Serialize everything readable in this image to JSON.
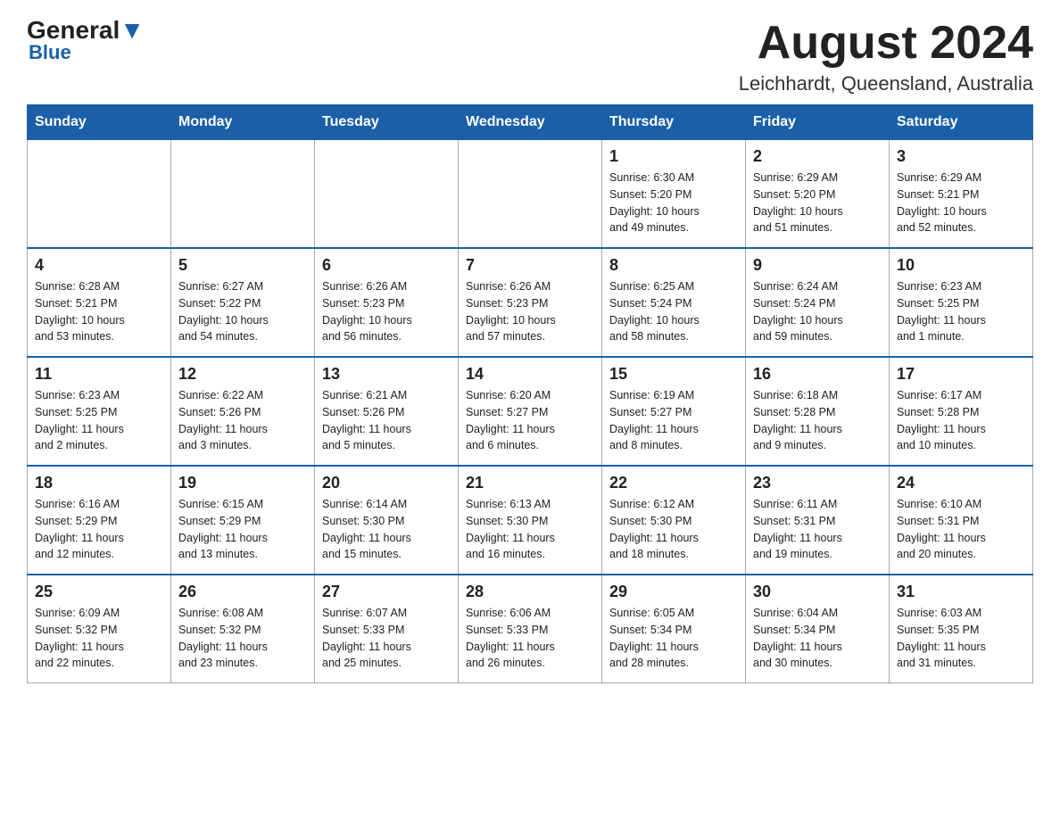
{
  "header": {
    "logo_general": "General",
    "logo_blue": "Blue",
    "month_title": "August 2024",
    "location": "Leichhardt, Queensland, Australia"
  },
  "days_of_week": [
    "Sunday",
    "Monday",
    "Tuesday",
    "Wednesday",
    "Thursday",
    "Friday",
    "Saturday"
  ],
  "weeks": [
    [
      {
        "day": "",
        "info": ""
      },
      {
        "day": "",
        "info": ""
      },
      {
        "day": "",
        "info": ""
      },
      {
        "day": "",
        "info": ""
      },
      {
        "day": "1",
        "info": "Sunrise: 6:30 AM\nSunset: 5:20 PM\nDaylight: 10 hours\nand 49 minutes."
      },
      {
        "day": "2",
        "info": "Sunrise: 6:29 AM\nSunset: 5:20 PM\nDaylight: 10 hours\nand 51 minutes."
      },
      {
        "day": "3",
        "info": "Sunrise: 6:29 AM\nSunset: 5:21 PM\nDaylight: 10 hours\nand 52 minutes."
      }
    ],
    [
      {
        "day": "4",
        "info": "Sunrise: 6:28 AM\nSunset: 5:21 PM\nDaylight: 10 hours\nand 53 minutes."
      },
      {
        "day": "5",
        "info": "Sunrise: 6:27 AM\nSunset: 5:22 PM\nDaylight: 10 hours\nand 54 minutes."
      },
      {
        "day": "6",
        "info": "Sunrise: 6:26 AM\nSunset: 5:23 PM\nDaylight: 10 hours\nand 56 minutes."
      },
      {
        "day": "7",
        "info": "Sunrise: 6:26 AM\nSunset: 5:23 PM\nDaylight: 10 hours\nand 57 minutes."
      },
      {
        "day": "8",
        "info": "Sunrise: 6:25 AM\nSunset: 5:24 PM\nDaylight: 10 hours\nand 58 minutes."
      },
      {
        "day": "9",
        "info": "Sunrise: 6:24 AM\nSunset: 5:24 PM\nDaylight: 10 hours\nand 59 minutes."
      },
      {
        "day": "10",
        "info": "Sunrise: 6:23 AM\nSunset: 5:25 PM\nDaylight: 11 hours\nand 1 minute."
      }
    ],
    [
      {
        "day": "11",
        "info": "Sunrise: 6:23 AM\nSunset: 5:25 PM\nDaylight: 11 hours\nand 2 minutes."
      },
      {
        "day": "12",
        "info": "Sunrise: 6:22 AM\nSunset: 5:26 PM\nDaylight: 11 hours\nand 3 minutes."
      },
      {
        "day": "13",
        "info": "Sunrise: 6:21 AM\nSunset: 5:26 PM\nDaylight: 11 hours\nand 5 minutes."
      },
      {
        "day": "14",
        "info": "Sunrise: 6:20 AM\nSunset: 5:27 PM\nDaylight: 11 hours\nand 6 minutes."
      },
      {
        "day": "15",
        "info": "Sunrise: 6:19 AM\nSunset: 5:27 PM\nDaylight: 11 hours\nand 8 minutes."
      },
      {
        "day": "16",
        "info": "Sunrise: 6:18 AM\nSunset: 5:28 PM\nDaylight: 11 hours\nand 9 minutes."
      },
      {
        "day": "17",
        "info": "Sunrise: 6:17 AM\nSunset: 5:28 PM\nDaylight: 11 hours\nand 10 minutes."
      }
    ],
    [
      {
        "day": "18",
        "info": "Sunrise: 6:16 AM\nSunset: 5:29 PM\nDaylight: 11 hours\nand 12 minutes."
      },
      {
        "day": "19",
        "info": "Sunrise: 6:15 AM\nSunset: 5:29 PM\nDaylight: 11 hours\nand 13 minutes."
      },
      {
        "day": "20",
        "info": "Sunrise: 6:14 AM\nSunset: 5:30 PM\nDaylight: 11 hours\nand 15 minutes."
      },
      {
        "day": "21",
        "info": "Sunrise: 6:13 AM\nSunset: 5:30 PM\nDaylight: 11 hours\nand 16 minutes."
      },
      {
        "day": "22",
        "info": "Sunrise: 6:12 AM\nSunset: 5:30 PM\nDaylight: 11 hours\nand 18 minutes."
      },
      {
        "day": "23",
        "info": "Sunrise: 6:11 AM\nSunset: 5:31 PM\nDaylight: 11 hours\nand 19 minutes."
      },
      {
        "day": "24",
        "info": "Sunrise: 6:10 AM\nSunset: 5:31 PM\nDaylight: 11 hours\nand 20 minutes."
      }
    ],
    [
      {
        "day": "25",
        "info": "Sunrise: 6:09 AM\nSunset: 5:32 PM\nDaylight: 11 hours\nand 22 minutes."
      },
      {
        "day": "26",
        "info": "Sunrise: 6:08 AM\nSunset: 5:32 PM\nDaylight: 11 hours\nand 23 minutes."
      },
      {
        "day": "27",
        "info": "Sunrise: 6:07 AM\nSunset: 5:33 PM\nDaylight: 11 hours\nand 25 minutes."
      },
      {
        "day": "28",
        "info": "Sunrise: 6:06 AM\nSunset: 5:33 PM\nDaylight: 11 hours\nand 26 minutes."
      },
      {
        "day": "29",
        "info": "Sunrise: 6:05 AM\nSunset: 5:34 PM\nDaylight: 11 hours\nand 28 minutes."
      },
      {
        "day": "30",
        "info": "Sunrise: 6:04 AM\nSunset: 5:34 PM\nDaylight: 11 hours\nand 30 minutes."
      },
      {
        "day": "31",
        "info": "Sunrise: 6:03 AM\nSunset: 5:35 PM\nDaylight: 11 hours\nand 31 minutes."
      }
    ]
  ]
}
